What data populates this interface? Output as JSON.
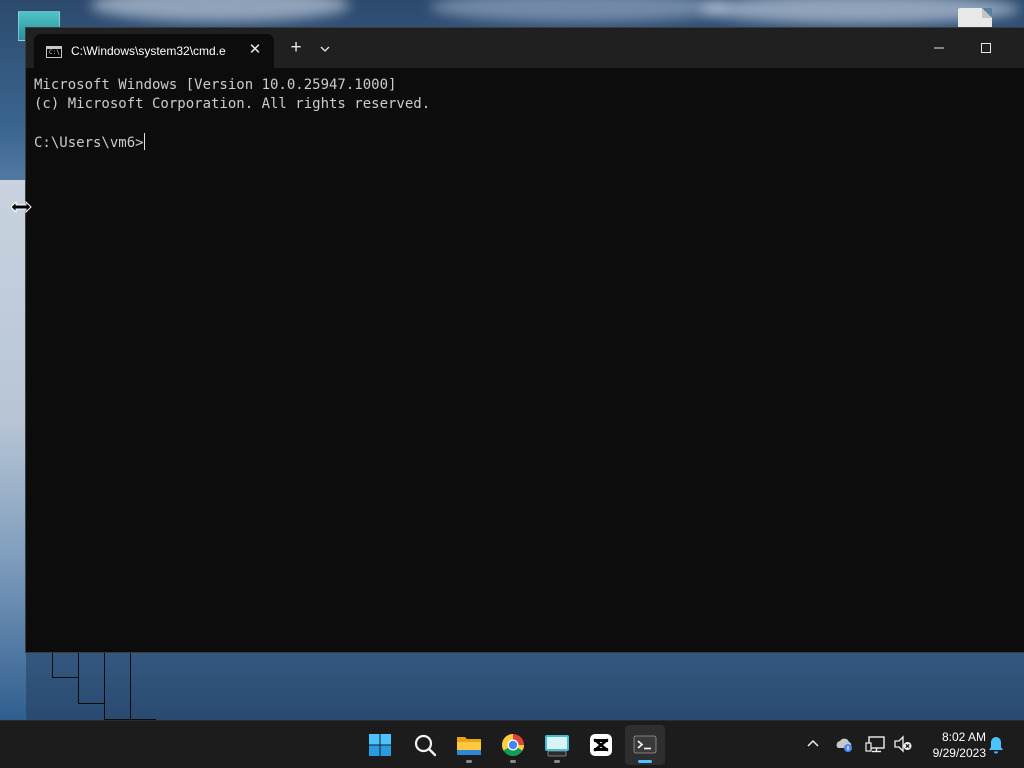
{
  "terminal": {
    "tab_title": "C:\\Windows\\system32\\cmd.e",
    "tab_icon_glyph": "C:\\",
    "close_glyph": "✕",
    "new_tab_glyph": "+",
    "console": {
      "line1": "Microsoft Windows [Version 10.0.25947.1000]",
      "line2": "(c) Microsoft Corporation. All rights reserved.",
      "line3": "",
      "prompt": "C:\\Users\\vm6>"
    },
    "colors": {
      "background": "#0c0c0c",
      "titlebar": "#202020",
      "text": "#cccccc"
    }
  },
  "taskbar": {
    "icons": [
      "windows-start-icon",
      "search-icon",
      "file-explorer-icon",
      "chrome-icon",
      "keyboard-app-icon",
      "capcut-icon",
      "terminal-icon"
    ],
    "tray_icons": [
      "chevron-up-icon",
      "onedrive-icon",
      "network-icon",
      "volume-muted-icon",
      "notification-bell-icon"
    ],
    "time": "8:02 AM",
    "date": "9/29/2023",
    "accent": "#4cc2ff"
  }
}
